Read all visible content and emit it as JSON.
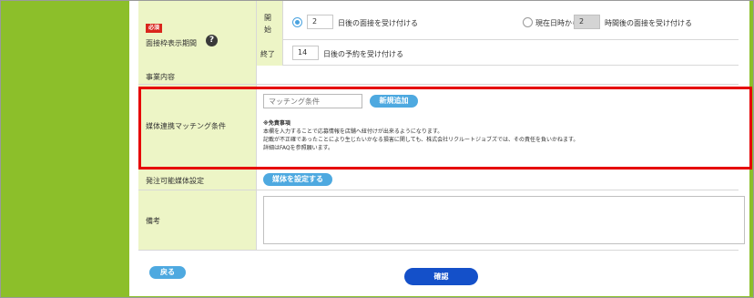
{
  "interview_period": {
    "required_badge": "必須",
    "label": "面接枠表示期間",
    "help_icon": "?",
    "start": {
      "label": "開始",
      "option_days_value": "2",
      "option_days_text": "日後の面接を受け付ける",
      "option_hours_prefix": "現在日時から",
      "option_hours_value": "2",
      "option_hours_text": "時間後の面接を受け付ける"
    },
    "end": {
      "label": "終了",
      "days_value": "14",
      "days_text": "日後の予約を受け付ける"
    }
  },
  "business_content": {
    "label": "事業内容"
  },
  "media_matching": {
    "label": "媒体連携マッチング条件",
    "input_placeholder": "マッチング条件",
    "add_button": "新規追加",
    "disclaimer_title": "※免責事項",
    "disclaimer_lines": [
      "本欄を入力することで応募情報を店舗へ紐付けが出来るようになります。",
      "記載が不正確であったことにより生じたいかなる損害に関しても、株式会社リクルートジョブズでは、その責任を負いかねます。",
      "詳細はFAQを参照願います。"
    ]
  },
  "media_setting": {
    "label": "発注可能媒体設定",
    "button": "媒体を設定する"
  },
  "remarks": {
    "label": "備考"
  },
  "footer": {
    "back_button": "戻る",
    "confirm_button": "確認"
  },
  "colors": {
    "sidebar": "#8cbf2a",
    "label_bg": "#edf5c6",
    "accent": "#4ea9e0",
    "confirm": "#1450c9",
    "highlight": "#e60000"
  }
}
